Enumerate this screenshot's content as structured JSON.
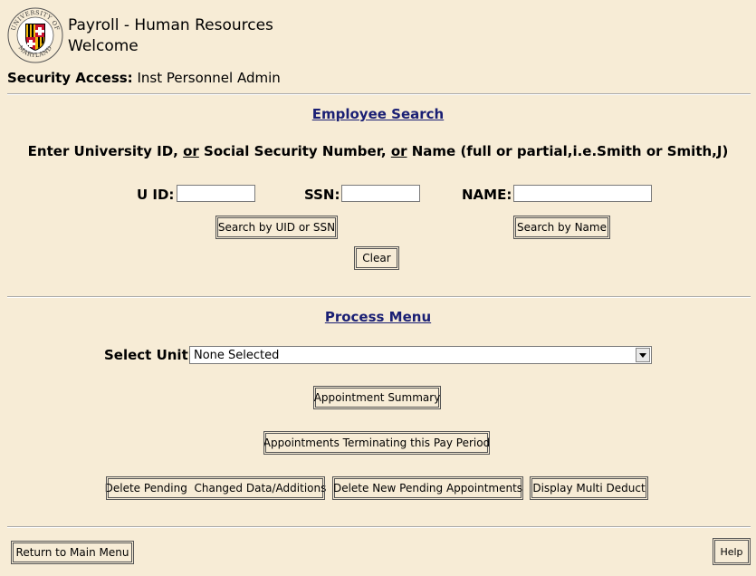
{
  "header": {
    "title": "Payroll - Human Resources",
    "subtitle": "Welcome",
    "logo_text": "UNIVERSITY OF MARYLAND"
  },
  "security": {
    "label": "Security Access:",
    "value": "Inst Personnel Admin"
  },
  "employee_search": {
    "title": "Employee Search",
    "instr_part1": "Enter University ID, ",
    "instr_or1": "or",
    "instr_part2": " Social Security Number, ",
    "instr_or2": "or",
    "instr_part3": " Name (full or partial,i.e.Smith or Smith,J)",
    "uid_label": "U ID:",
    "uid_value": "",
    "ssn_label": "SSN:",
    "ssn_value": "",
    "name_label": "NAME:",
    "name_value": "",
    "search_uid_ssn_label": "Search by UID or SSN",
    "search_name_label": "Search by Name",
    "clear_label": "Clear"
  },
  "process_menu": {
    "title": "Process Menu",
    "select_unit_label": "Select Unit:",
    "select_unit_value": "None Selected",
    "appointment_summary_label": "Appointment Summary",
    "terminating_label": "Appointments Terminating this Pay Period",
    "delete_changed_label": "Delete Pending  Changed Data/Additions",
    "delete_new_label": "Delete New Pending Appointments",
    "multi_deduct_label": "Display Multi Deduct"
  },
  "footer": {
    "return_label": "Return to Main Menu",
    "help_label": "Help"
  },
  "colors": {
    "background": "#f7ecd6",
    "section_title": "#1a1f74",
    "maryland_red": "#c8102e",
    "maryland_gold": "#f2b90d"
  }
}
